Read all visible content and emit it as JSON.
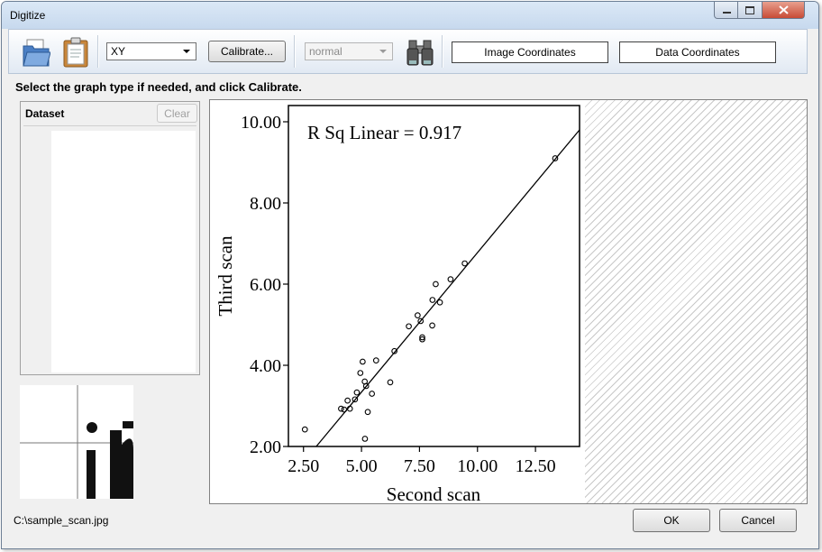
{
  "window": {
    "title": "Digitize"
  },
  "toolbar": {
    "graph_type": "XY",
    "calibrate_label": "Calibrate...",
    "mode_value": "normal",
    "image_coords_label": "Image Coordinates",
    "data_coords_label": "Data Coordinates"
  },
  "instruction": "Select the graph type if needed, and click Calibrate.",
  "dataset": {
    "label": "Dataset",
    "clear_label": "Clear"
  },
  "status": {
    "file_path": "C:\\sample_scan.jpg"
  },
  "buttons": {
    "ok": "OK",
    "cancel": "Cancel"
  },
  "colors": {
    "accent": "#c7d9ee",
    "close": "#c84b36"
  },
  "chart_data": {
    "type": "scatter",
    "annotation": "R Sq Linear = 0.917",
    "xlabel": "Second scan",
    "ylabel": "Third scan",
    "xlim": [
      1.85,
      14.4
    ],
    "ylim": [
      2.0,
      10.4
    ],
    "x_ticks": [
      "2.50",
      "5.00",
      "7.50",
      "10.00",
      "12.50"
    ],
    "y_ticks": [
      "2.00",
      "4.00",
      "6.00",
      "8.00",
      "10.00"
    ],
    "grid": false,
    "points": [
      [
        2.56,
        2.42
      ],
      [
        4.12,
        2.93
      ],
      [
        4.25,
        2.91
      ],
      [
        4.4,
        3.13
      ],
      [
        4.5,
        2.93
      ],
      [
        4.72,
        3.16
      ],
      [
        4.8,
        3.33
      ],
      [
        4.95,
        3.81
      ],
      [
        5.05,
        4.09
      ],
      [
        5.14,
        3.6
      ],
      [
        5.2,
        3.49
      ],
      [
        5.15,
        2.19
      ],
      [
        5.27,
        2.85
      ],
      [
        5.45,
        3.3
      ],
      [
        5.63,
        4.12
      ],
      [
        6.24,
        3.58
      ],
      [
        6.42,
        4.35
      ],
      [
        7.04,
        4.96
      ],
      [
        7.42,
        5.23
      ],
      [
        7.55,
        5.09
      ],
      [
        7.62,
        4.64
      ],
      [
        7.62,
        4.69
      ],
      [
        8.05,
        4.98
      ],
      [
        8.06,
        5.61
      ],
      [
        8.2,
        6.0
      ],
      [
        8.38,
        5.55
      ],
      [
        8.84,
        6.12
      ],
      [
        9.45,
        6.51
      ],
      [
        13.35,
        9.1
      ]
    ],
    "fit_line": {
      "x": [
        3.05,
        14.4
      ],
      "y": [
        2.0,
        9.8
      ]
    }
  }
}
